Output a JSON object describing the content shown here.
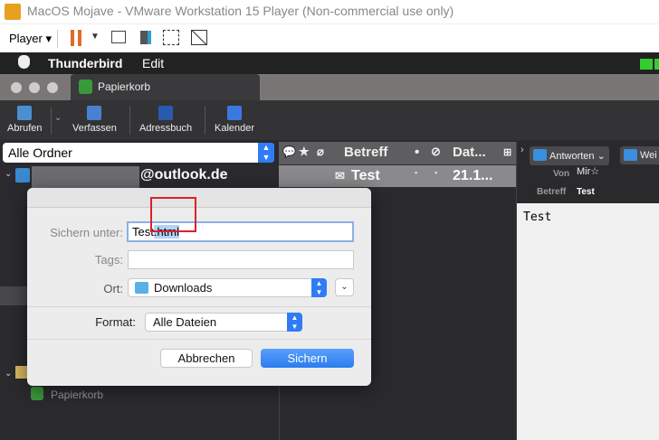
{
  "vmware": {
    "title": "MacOS Mojave - VMware Workstation 15 Player (Non-commercial use only)",
    "player_menu": "Player ▾"
  },
  "mac_menu": {
    "apple": "",
    "app": "Thunderbird",
    "edit": "Edit"
  },
  "tab": {
    "label": "Papierkorb"
  },
  "toolbar": {
    "get": "Abrufen",
    "compose": "Verfassen",
    "addressbook": "Adressbuch",
    "calendar": "Kalender"
  },
  "folders": {
    "selector": "Alle Ordner",
    "account": "@outlook.de",
    "trash": "Papierkorb"
  },
  "list": {
    "col_subject": "Betreff",
    "col_date": "Dat...",
    "row": {
      "subject": "Test",
      "date": "21.1..."
    }
  },
  "preview": {
    "reply": "Antworten",
    "forward": "Wei",
    "from_label": "Von",
    "from": "Mir",
    "subject_label": "Betreff",
    "subject": "Test",
    "body": "Test"
  },
  "dialog": {
    "save_as_label": "Sichern unter:",
    "filename_base": "Test",
    "filename_ext": ".html",
    "tags_label": "Tags:",
    "tags_value": "",
    "location_label": "Ort:",
    "location": "Downloads",
    "format_label": "Format:",
    "format": "Alle Dateien",
    "cancel": "Abbrechen",
    "save": "Sichern"
  }
}
